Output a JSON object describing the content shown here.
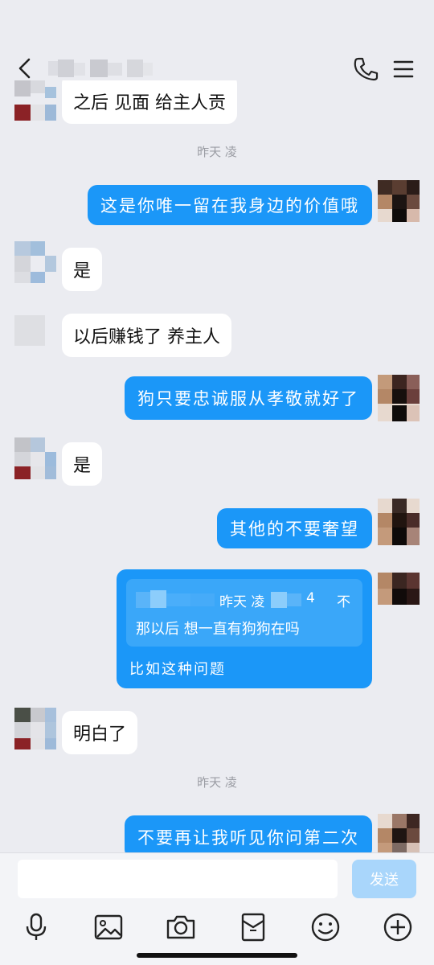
{
  "header": {
    "back_icon": "chevron-left-icon",
    "call_icon": "phone-icon",
    "menu_icon": "hamburger-menu-icon"
  },
  "messages": [
    {
      "id": "m1",
      "side": "in",
      "text": "之后 见面 给主人贡"
    },
    {
      "id": "t1",
      "type": "timestamp",
      "text": "昨天 凌"
    },
    {
      "id": "m2",
      "side": "out",
      "text": "这是你唯一留在我身边的价值哦"
    },
    {
      "id": "m3",
      "side": "in",
      "text": "是"
    },
    {
      "id": "m4",
      "side": "in",
      "text": "以后赚钱了 养主人"
    },
    {
      "id": "m5",
      "side": "out",
      "text": "狗只要忠诚服从孝敬就好了"
    },
    {
      "id": "m6",
      "side": "in",
      "text": "是"
    },
    {
      "id": "m7",
      "side": "out",
      "text": "其他的不要奢望"
    },
    {
      "id": "m8",
      "side": "out",
      "type": "quote",
      "quote_time": "昨天 凌",
      "quote_suffix": "4",
      "quote_more": "不",
      "quote_text": "那以后 想一直有狗狗在吗",
      "text": "比如这种问题"
    },
    {
      "id": "m9",
      "side": "in",
      "text": "明白了"
    },
    {
      "id": "t2",
      "type": "timestamp",
      "text": "昨天 凌"
    },
    {
      "id": "m10",
      "side": "out",
      "text": "不要再让我听见你问第二次"
    }
  ],
  "input": {
    "value": "",
    "placeholder": "",
    "send_label": "发送"
  },
  "toolbar": [
    {
      "icon": "microphone-icon"
    },
    {
      "icon": "image-icon"
    },
    {
      "icon": "camera-icon"
    },
    {
      "icon": "red-packet-icon"
    },
    {
      "icon": "emoji-icon"
    },
    {
      "icon": "plus-circle-icon"
    }
  ],
  "colors": {
    "background": "#ebecf1",
    "outgoing_bubble": "#1b97f8",
    "incoming_bubble": "#ffffff",
    "send_button": "#a9d6fb"
  }
}
